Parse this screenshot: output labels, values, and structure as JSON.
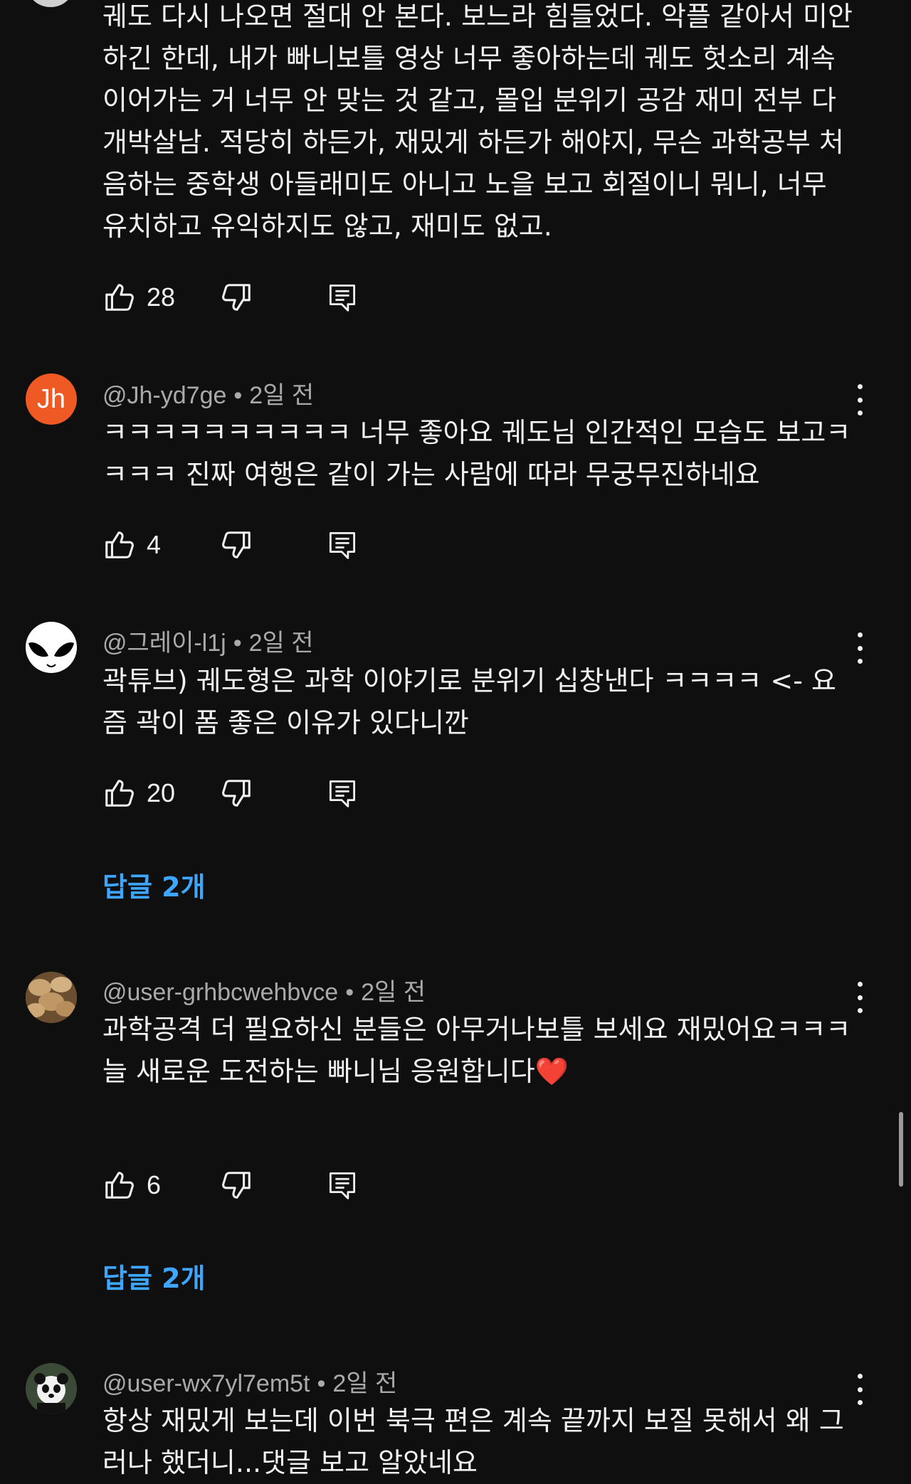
{
  "comments": [
    {
      "text": "궤도 다시 나오면 절대 안 본다. 보느라 힘들었다. 악플 같아서 미안하긴 한데, 내가 빠니보틀 영상 너무 좋아하는데 궤도 헛소리 계속 이어가는 거 너무 안 맞는 것 같고, 몰입 분위기 공감 재미 전부 다 개박살남. 적당히 하든가, 재밌게 하든가 해야지, 무슨 과학공부 처음하는 중학생 아들래미도 아니고 노을 보고 회절이니 뭐니, 너무 유치하고 유익하지도 않고, 재미도 없고.",
      "likes": "28"
    },
    {
      "author": "@Jh-yd7ge",
      "avatar_text": "Jh",
      "time": "2일 전",
      "text": "ㅋㅋㅋㅋㅋㅋㅋㅋㅋㅋ 너무 좋아요 궤도님 인간적인 모습도 보고ㅋㅋㅋㅋ 진짜 여행은 같이 가는 사람에 따라 무궁무진하네요",
      "likes": "4"
    },
    {
      "author": "@그레이-l1j",
      "time": "2일 전",
      "text": "곽튜브) 궤도형은 과학 이야기로 분위기 십창낸다 ㅋㅋㅋㅋ <- 요즘 곽이 폼 좋은 이유가 있다니깐",
      "likes": "20",
      "replies": "답글 2개"
    },
    {
      "author": "@user-grhbcwehbvce",
      "time": "2일 전",
      "text_line1": "과학공격 더 필요하신 분들은 아무거나보틀 보세요 재밌어요ㅋㅋㅋ",
      "text_line2": "늘 새로운 도전하는 빠니님 응원합니다",
      "emoji": "❤️",
      "likes": "6",
      "replies": "답글 2개"
    },
    {
      "author": "@user-wx7yl7em5t",
      "time": "2일 전",
      "text": "항상 재밌게 보는데 이번 북극 편은 계속 끝까지 보질 못해서 왜 그러나 했더니...댓글 보고 알았네요"
    }
  ],
  "icons": {
    "like": "thumbs-up-icon",
    "dislike": "thumbs-down-icon",
    "reply": "reply-comment-icon",
    "more": "more-vertical-icon"
  },
  "colors": {
    "background": "#0f0f0f",
    "text": "#f1f1f1",
    "meta": "#aaaaaa",
    "link": "#3ea6ff",
    "avatar_jh": "#ef5a24"
  }
}
